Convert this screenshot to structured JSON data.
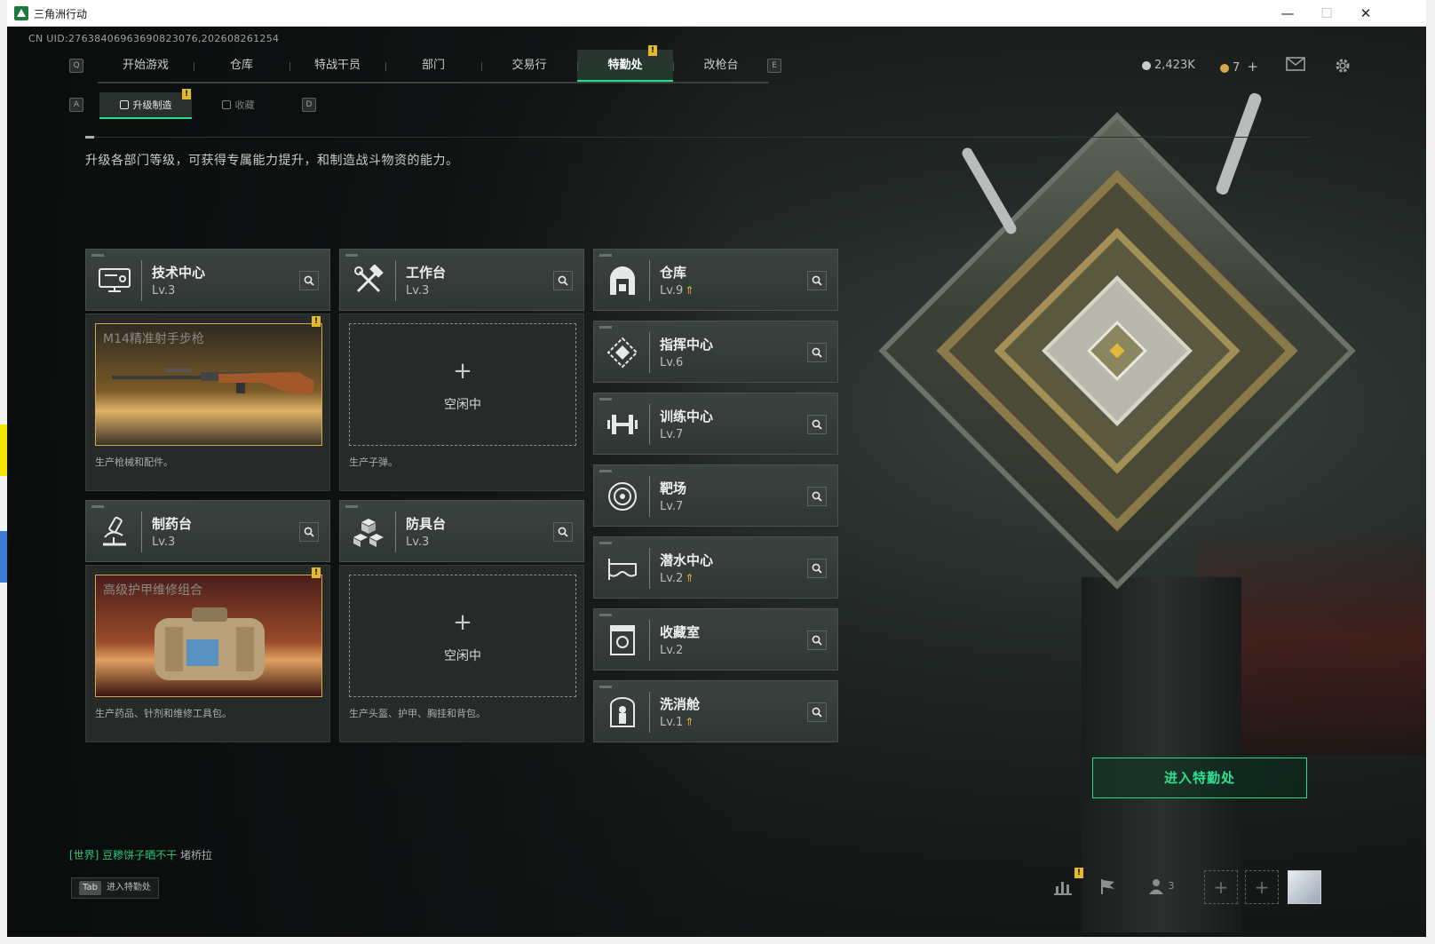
{
  "window": {
    "title": "三角洲行动",
    "min": "—",
    "max": "☐",
    "close": "✕"
  },
  "uid": "CN UID:27638406963690823076,202608261254",
  "nav": {
    "key_left": "Q",
    "key_right": "E",
    "items": [
      "开始游戏",
      "仓库",
      "特战干员",
      "部门",
      "交易行",
      "特勤处",
      "改枪台"
    ],
    "active": "特勤处",
    "alert": "!"
  },
  "currency": {
    "silver": "2,423K",
    "gold": "7",
    "gold_add": "+"
  },
  "subtabs": {
    "key_left": "A",
    "key_right": "D",
    "items": [
      "升级制造",
      "收藏"
    ],
    "alert": "!"
  },
  "description": "升级各部门等级，可获得专属能力提升，和制造战斗物资的能力。",
  "workshops": [
    {
      "name": "技术中心",
      "level": "Lv.3",
      "status": "producing",
      "product": "M14精准射手步枪",
      "desc": "生产枪械和配件。",
      "alert": "!"
    },
    {
      "name": "工作台",
      "level": "Lv.3",
      "status": "idle",
      "idle_label": "空闲中",
      "desc": "生产子弹。"
    },
    {
      "name": "制药台",
      "level": "Lv.3",
      "status": "producing",
      "product": "高级护甲维修组合",
      "desc": "生产药品、针剂和维修工具包。",
      "alert": "!"
    },
    {
      "name": "防具台",
      "level": "Lv.3",
      "status": "idle",
      "idle_label": "空闲中",
      "desc": "生产头盔、护甲、胸挂和背包。"
    }
  ],
  "departments": [
    {
      "name": "仓库",
      "level": "Lv.9",
      "upgrade": true
    },
    {
      "name": "指挥中心",
      "level": "Lv.6",
      "upgrade": false
    },
    {
      "name": "训练中心",
      "level": "Lv.7",
      "upgrade": false
    },
    {
      "name": "靶场",
      "level": "Lv.7",
      "upgrade": false
    },
    {
      "name": "潜水中心",
      "level": "Lv.2",
      "upgrade": true
    },
    {
      "name": "收藏室",
      "level": "Lv.2",
      "upgrade": false
    },
    {
      "name": "洗消舱",
      "level": "Lv.1",
      "upgrade": true
    }
  ],
  "enter_button": "进入特勤处",
  "chat": {
    "channel": "[世界]",
    "user": "豆糁饼子晒不干",
    "message": "堵桥拉"
  },
  "tab_hint": {
    "key": "Tab",
    "label": "进入特勤处"
  },
  "friends_count": "3",
  "colors": {
    "accent": "#2fd88a",
    "alert": "#e5b92c",
    "product_border": "#d4a94e"
  }
}
